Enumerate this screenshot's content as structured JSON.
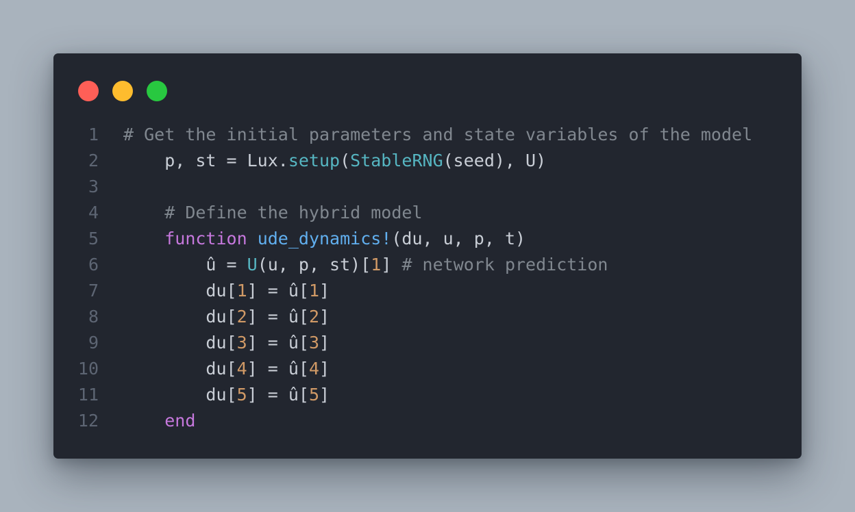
{
  "window": {
    "controls": {
      "close": {
        "icon": "close-dot-icon",
        "color": "#ff5f57"
      },
      "minimize": {
        "icon": "minimize-dot-icon",
        "color": "#febc2e"
      },
      "maximize": {
        "icon": "maximize-dot-icon",
        "color": "#28c840"
      }
    }
  },
  "code": {
    "language": "julia",
    "lines": [
      {
        "number": "1",
        "tokens": [
          {
            "t": "comment",
            "text": "# Get the initial parameters and state variables of the model"
          }
        ]
      },
      {
        "number": "2",
        "tokens": [
          {
            "t": "plain",
            "text": "    p, st = Lux."
          },
          {
            "t": "call",
            "text": "setup"
          },
          {
            "t": "plain",
            "text": "("
          },
          {
            "t": "call",
            "text": "StableRNG"
          },
          {
            "t": "plain",
            "text": "(seed), U)"
          }
        ]
      },
      {
        "number": "3",
        "tokens": []
      },
      {
        "number": "4",
        "tokens": [
          {
            "t": "plain",
            "text": "    "
          },
          {
            "t": "comment",
            "text": "# Define the hybrid model"
          }
        ]
      },
      {
        "number": "5",
        "tokens": [
          {
            "t": "plain",
            "text": "    "
          },
          {
            "t": "kw",
            "text": "function"
          },
          {
            "t": "plain",
            "text": " "
          },
          {
            "t": "fn",
            "text": "ude_dynamics!"
          },
          {
            "t": "plain",
            "text": "(du, u, p, t)"
          }
        ]
      },
      {
        "number": "6",
        "tokens": [
          {
            "t": "plain",
            "text": "        û = "
          },
          {
            "t": "call",
            "text": "U"
          },
          {
            "t": "plain",
            "text": "(u, p, st)["
          },
          {
            "t": "num",
            "text": "1"
          },
          {
            "t": "plain",
            "text": "] "
          },
          {
            "t": "comment",
            "text": "# network prediction"
          }
        ]
      },
      {
        "number": "7",
        "tokens": [
          {
            "t": "plain",
            "text": "        du["
          },
          {
            "t": "num",
            "text": "1"
          },
          {
            "t": "plain",
            "text": "] = û["
          },
          {
            "t": "num",
            "text": "1"
          },
          {
            "t": "plain",
            "text": "]"
          }
        ]
      },
      {
        "number": "8",
        "tokens": [
          {
            "t": "plain",
            "text": "        du["
          },
          {
            "t": "num",
            "text": "2"
          },
          {
            "t": "plain",
            "text": "] = û["
          },
          {
            "t": "num",
            "text": "2"
          },
          {
            "t": "plain",
            "text": "]"
          }
        ]
      },
      {
        "number": "9",
        "tokens": [
          {
            "t": "plain",
            "text": "        du["
          },
          {
            "t": "num",
            "text": "3"
          },
          {
            "t": "plain",
            "text": "] = û["
          },
          {
            "t": "num",
            "text": "3"
          },
          {
            "t": "plain",
            "text": "]"
          }
        ]
      },
      {
        "number": "10",
        "tokens": [
          {
            "t": "plain",
            "text": "        du["
          },
          {
            "t": "num",
            "text": "4"
          },
          {
            "t": "plain",
            "text": "] = û["
          },
          {
            "t": "num",
            "text": "4"
          },
          {
            "t": "plain",
            "text": "]"
          }
        ]
      },
      {
        "number": "11",
        "tokens": [
          {
            "t": "plain",
            "text": "        du["
          },
          {
            "t": "num",
            "text": "5"
          },
          {
            "t": "plain",
            "text": "] = û["
          },
          {
            "t": "num",
            "text": "5"
          },
          {
            "t": "plain",
            "text": "]"
          }
        ]
      },
      {
        "number": "12",
        "tokens": [
          {
            "t": "plain",
            "text": "    "
          },
          {
            "t": "kw",
            "text": "end"
          }
        ]
      }
    ]
  },
  "theme": {
    "page_background": "#a9b3bd",
    "editor_background": "#22262f",
    "text": "#c9ced6",
    "comment": "#80878f",
    "keyword": "#c678dd",
    "function_name": "#61afef",
    "call": "#56b6c2",
    "number": "#d19a66",
    "line_number": "#5d6573"
  }
}
